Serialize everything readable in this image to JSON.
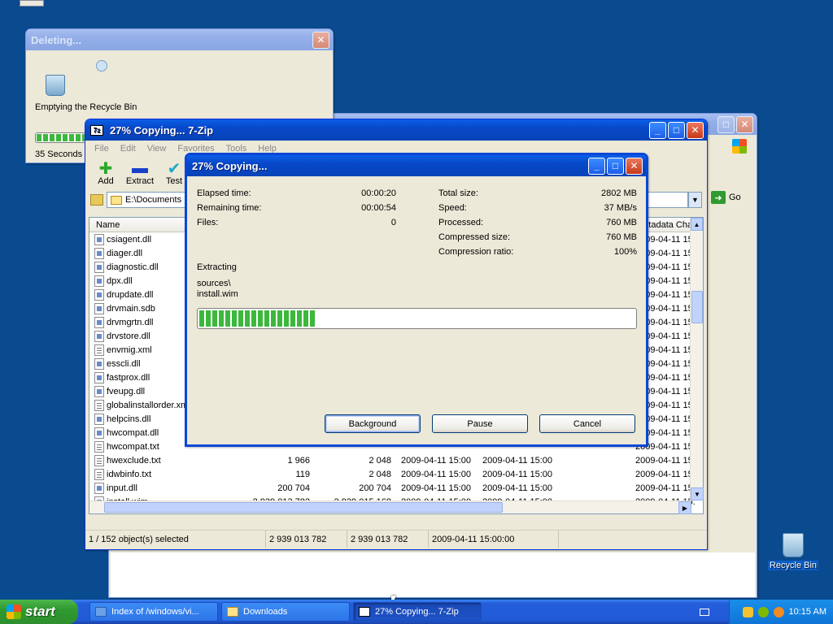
{
  "deleting_window": {
    "title": "Deleting...",
    "message": "Emptying the Recycle Bin",
    "remaining": "35 Seconds R"
  },
  "main_window": {
    "title": "27% Copying... 7-Zip",
    "menu": [
      "File",
      "Edit",
      "View",
      "Favorites",
      "Tools",
      "Help"
    ],
    "toolbar": {
      "add": "Add",
      "extract": "Extract",
      "test": "Test"
    },
    "address": "E:\\Documents",
    "columns": {
      "name": "Name",
      "metadata": "Metadata Cha..."
    },
    "files": [
      {
        "name": "csiagent.dll",
        "size": "",
        "packed": "",
        "modified": "",
        "created": "",
        "meta": "2009-04-11 15:"
      },
      {
        "name": "diager.dll",
        "size": "",
        "packed": "",
        "modified": "",
        "created": "",
        "meta": "2009-04-11 15:"
      },
      {
        "name": "diagnostic.dll",
        "size": "",
        "packed": "",
        "modified": "",
        "created": "",
        "meta": "2009-04-11 15:"
      },
      {
        "name": "dpx.dll",
        "size": "",
        "packed": "",
        "modified": "",
        "created": "",
        "meta": "2009-04-11 15:"
      },
      {
        "name": "drupdate.dll",
        "size": "",
        "packed": "",
        "modified": "",
        "created": "",
        "meta": "2009-04-11 15:"
      },
      {
        "name": "drvmain.sdb",
        "size": "",
        "packed": "",
        "modified": "",
        "created": "",
        "meta": "2009-04-11 15:"
      },
      {
        "name": "drvmgrtn.dll",
        "size": "",
        "packed": "",
        "modified": "",
        "created": "",
        "meta": "2009-04-11 15:"
      },
      {
        "name": "drvstore.dll",
        "size": "",
        "packed": "",
        "modified": "",
        "created": "",
        "meta": "2009-04-11 15:"
      },
      {
        "name": "envmig.xml",
        "size": "",
        "packed": "",
        "modified": "",
        "created": "",
        "meta": "2009-04-11 15:"
      },
      {
        "name": "esscli.dll",
        "size": "",
        "packed": "",
        "modified": "",
        "created": "",
        "meta": "2009-04-11 15:"
      },
      {
        "name": "fastprox.dll",
        "size": "",
        "packed": "",
        "modified": "",
        "created": "",
        "meta": "2009-04-11 15:"
      },
      {
        "name": "fveupg.dll",
        "size": "",
        "packed": "",
        "modified": "",
        "created": "",
        "meta": "2009-04-11 15:"
      },
      {
        "name": "globalinstallorder.xml",
        "size": "",
        "packed": "",
        "modified": "",
        "created": "",
        "meta": "2009-04-11 15:"
      },
      {
        "name": "helpcins.dll",
        "size": "",
        "packed": "",
        "modified": "",
        "created": "",
        "meta": "2009-04-11 15:"
      },
      {
        "name": "hwcompat.dll",
        "size": "",
        "packed": "",
        "modified": "",
        "created": "",
        "meta": "2009-04-11 15:"
      },
      {
        "name": "hwcompat.txt",
        "size": "",
        "packed": "",
        "modified": "",
        "created": "",
        "meta": "2009-04-11 15:"
      },
      {
        "name": "hwexclude.txt",
        "size": "1 966",
        "packed": "2 048",
        "modified": "2009-04-11 15:00",
        "created": "2009-04-11 15:00",
        "meta": "2009-04-11 15:"
      },
      {
        "name": "idwbinfo.txt",
        "size": "119",
        "packed": "2 048",
        "modified": "2009-04-11 15:00",
        "created": "2009-04-11 15:00",
        "meta": "2009-04-11 15:"
      },
      {
        "name": "input.dll",
        "size": "200 704",
        "packed": "200 704",
        "modified": "2009-04-11 15:00",
        "created": "2009-04-11 15:00",
        "meta": "2009-04-11 15:"
      },
      {
        "name": "install.wim",
        "size": "2 939 013 782",
        "packed": "2 939 015 168",
        "modified": "2009-04-11 15:00",
        "created": "2009-04-11 15:00",
        "meta": "2009-04-11 15:"
      }
    ],
    "status": {
      "selected": "1 / 152 object(s) selected",
      "size": "2 939 013 782",
      "packed": "2 939 013 782",
      "modified": "2009-04-11 15:00:00"
    }
  },
  "back_window": {
    "go": "Go"
  },
  "copy_dialog": {
    "title": "27% Copying...",
    "elapsed_label": "Elapsed time:",
    "elapsed": "00:00:20",
    "remaining_label": "Remaining time:",
    "remaining": "00:00:54",
    "files_label": "Files:",
    "files": "0",
    "total_label": "Total size:",
    "total": "2802 MB",
    "speed_label": "Speed:",
    "speed": "37 MB/s",
    "processed_label": "Processed:",
    "processed": "760 MB",
    "compressed_label": "Compressed size:",
    "compressed": "760 MB",
    "ratio_label": "Compression ratio:",
    "ratio": "100%",
    "action": "Extracting",
    "path1": "sources\\",
    "path2": "install.wim",
    "progress": 0.27,
    "buttons": {
      "background": "Background",
      "pause": "Pause",
      "cancel": "Cancel"
    }
  },
  "desktop": {
    "recycle_bin": "Recycle Bin"
  },
  "taskbar": {
    "start": "start",
    "tasks": [
      "Index of /windows/vi...",
      "Downloads",
      "27% Copying... 7-Zip"
    ],
    "clock": "10:15 AM"
  },
  "colors": {
    "desktop": "#0a4a8f",
    "xp_blue": "#0a5fe8",
    "progress_green": "#3cb83c"
  }
}
